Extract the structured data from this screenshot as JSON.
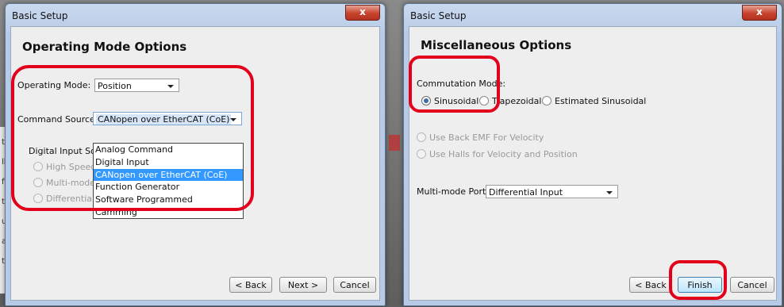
{
  "background": {
    "strip_chars": [
      "ta",
      "ll",
      "ff",
      "te",
      "ut",
      "ay",
      "tr"
    ]
  },
  "dialog1": {
    "title": "Basic Setup",
    "close": "x",
    "heading": "Operating Mode Options",
    "operating_mode_label": "Operating Mode:",
    "operating_mode_value": "Position",
    "command_source_label": "Command Source:",
    "command_source_value": "CANopen over EtherCAT (CoE)",
    "dropdown_options": [
      "Analog Command",
      "Digital Input",
      "CANopen over EtherCAT (CoE)",
      "Function Generator",
      "Software Programmed",
      "Camming"
    ],
    "digital_input_label": "Digital Input Sour",
    "radios": [
      "High Speed",
      "Multi-mode F",
      "Differential"
    ],
    "back": "< Back",
    "next": "Next >",
    "cancel": "Cancel"
  },
  "dialog2": {
    "title": "Basic Setup",
    "close": "x",
    "heading": "Miscellaneous Options",
    "commutation_label": "Commutation Mode:",
    "commutation_options": [
      "Sinusoidal",
      "Trapezoidal",
      "Estimated Sinusoidal"
    ],
    "use_back_emf": "Use Back EMF For Velocity",
    "use_halls": "Use Halls for Velocity and Position",
    "multimode_label": "Multi-mode Port:",
    "multimode_value": "Differential Input",
    "back": "< Back",
    "finish": "Finish",
    "cancel": "Cancel"
  },
  "colors": {
    "highlight": "#e3001b",
    "selection": "#3399ff"
  }
}
